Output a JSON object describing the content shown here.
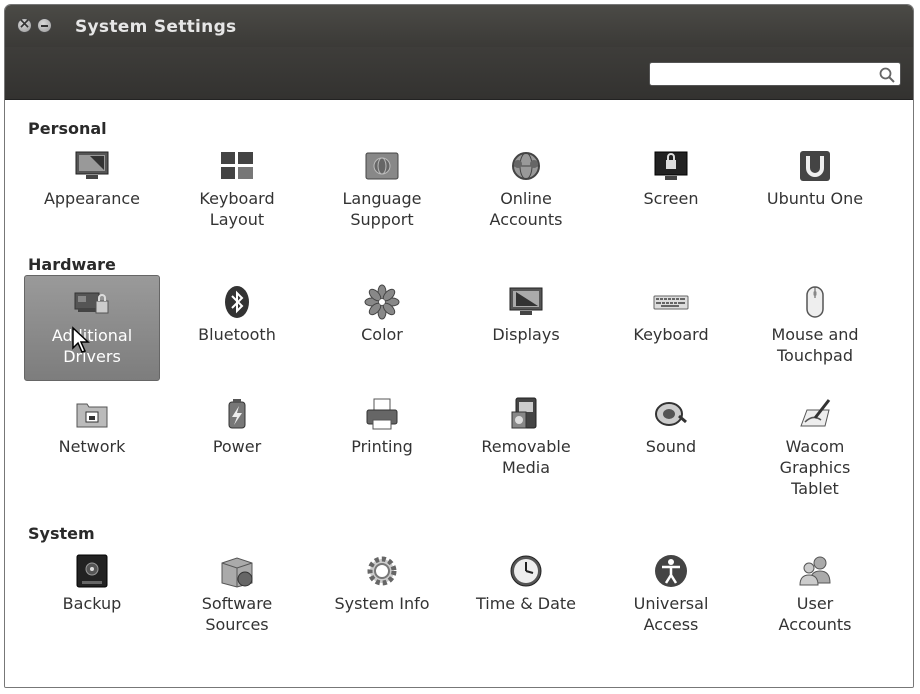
{
  "window": {
    "title": "System Settings"
  },
  "search": {
    "placeholder": "",
    "value": ""
  },
  "sections": [
    {
      "title": "Personal",
      "items": [
        {
          "label": "Appearance",
          "icon": "appearance-icon"
        },
        {
          "label": "Keyboard\nLayout",
          "icon": "keyboard-layout-icon"
        },
        {
          "label": "Language\nSupport",
          "icon": "language-support-icon"
        },
        {
          "label": "Online\nAccounts",
          "icon": "online-accounts-icon"
        },
        {
          "label": "Screen",
          "icon": "screen-lock-icon"
        },
        {
          "label": "Ubuntu One",
          "icon": "ubuntu-one-icon"
        }
      ]
    },
    {
      "title": "Hardware",
      "items": [
        {
          "label": "Additional\nDrivers",
          "icon": "additional-drivers-icon",
          "selected": true
        },
        {
          "label": "Bluetooth",
          "icon": "bluetooth-icon"
        },
        {
          "label": "Color",
          "icon": "color-icon"
        },
        {
          "label": "Displays",
          "icon": "displays-icon"
        },
        {
          "label": "Keyboard",
          "icon": "keyboard-icon"
        },
        {
          "label": "Mouse and\nTouchpad",
          "icon": "mouse-icon"
        },
        {
          "label": "Network",
          "icon": "network-icon"
        },
        {
          "label": "Power",
          "icon": "power-icon"
        },
        {
          "label": "Printing",
          "icon": "printer-icon"
        },
        {
          "label": "Removable\nMedia",
          "icon": "removable-media-icon"
        },
        {
          "label": "Sound",
          "icon": "sound-icon"
        },
        {
          "label": "Wacom\nGraphics\nTablet",
          "icon": "wacom-tablet-icon"
        }
      ]
    },
    {
      "title": "System",
      "items": [
        {
          "label": "Backup",
          "icon": "backup-icon"
        },
        {
          "label": "Software\nSources",
          "icon": "software-sources-icon"
        },
        {
          "label": "System Info",
          "icon": "system-info-icon"
        },
        {
          "label": "Time & Date",
          "icon": "clock-icon"
        },
        {
          "label": "Universal\nAccess",
          "icon": "universal-access-icon"
        },
        {
          "label": "User\nAccounts",
          "icon": "user-accounts-icon"
        }
      ]
    }
  ]
}
